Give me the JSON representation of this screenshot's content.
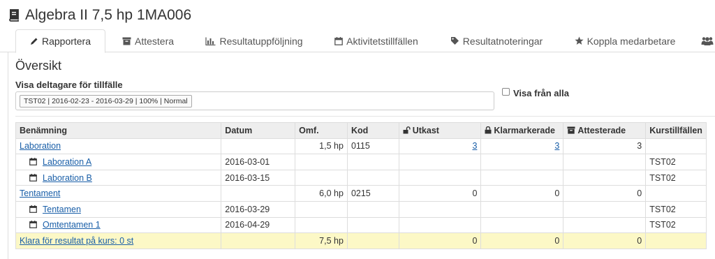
{
  "course_title": "Algebra II 7,5 hp 1MA006",
  "tabs": [
    {
      "label": "Rapportera",
      "icon": "pencil-icon",
      "active": true
    },
    {
      "label": "Attestera",
      "icon": "archive-icon"
    },
    {
      "label": "Resultatuppföljning",
      "icon": "bar-chart-icon"
    },
    {
      "label": "Aktivitetstillfällen",
      "icon": "calendar-icon"
    },
    {
      "label": "Resultatnoteringar",
      "icon": "tag-icon"
    },
    {
      "label": "Koppla medarbetare",
      "icon": "star-icon"
    },
    {
      "label": "",
      "icon": "users-icon"
    }
  ],
  "overview_heading": "Översikt",
  "participants_label": "Visa deltagare för tillfälle",
  "participants_selected": "TST02 | 2016-02-23 - 2016-03-29 | 100% | Normal",
  "show_all_label": "Visa från alla",
  "table": {
    "headers": {
      "name": "Benämning",
      "date": "Datum",
      "scope": "Omf.",
      "code": "Kod",
      "draft": "Utkast",
      "marked": "Klarmarkerade",
      "attested": "Attesterade",
      "instances": "Kurstillfällen"
    },
    "rows": [
      {
        "name": "Laboration",
        "date": "",
        "scope": "1,5 hp",
        "code": "0115",
        "draft": "3",
        "marked": "3",
        "attested": "3",
        "instances": ""
      },
      {
        "name": "Laboration A",
        "date": "2016-03-01",
        "scope": "",
        "code": "",
        "draft": "",
        "marked": "",
        "attested": "",
        "instances": "TST02"
      },
      {
        "name": "Laboration B",
        "date": "2016-03-15",
        "scope": "",
        "code": "",
        "draft": "",
        "marked": "",
        "attested": "",
        "instances": "TST02"
      },
      {
        "name": "Tentament",
        "date": "",
        "scope": "6,0 hp",
        "code": "0215",
        "draft": "0",
        "marked": "0",
        "attested": "0",
        "instances": ""
      },
      {
        "name": "Tentamen",
        "date": "2016-03-29",
        "scope": "",
        "code": "",
        "draft": "",
        "marked": "",
        "attested": "",
        "instances": "TST02"
      },
      {
        "name": "Omtentamen 1",
        "date": "2016-04-29",
        "scope": "",
        "code": "",
        "draft": "",
        "marked": "",
        "attested": "",
        "instances": "TST02"
      }
    ],
    "total": {
      "name": "Klara för resultat på kurs: 0 st",
      "scope": "7,5 hp",
      "draft": "0",
      "marked": "0",
      "attested": "0"
    }
  },
  "colors": {
    "link": "#1a5fa8",
    "total_row_bg": "#fcf8c6",
    "header_bg": "#eeeeee"
  }
}
